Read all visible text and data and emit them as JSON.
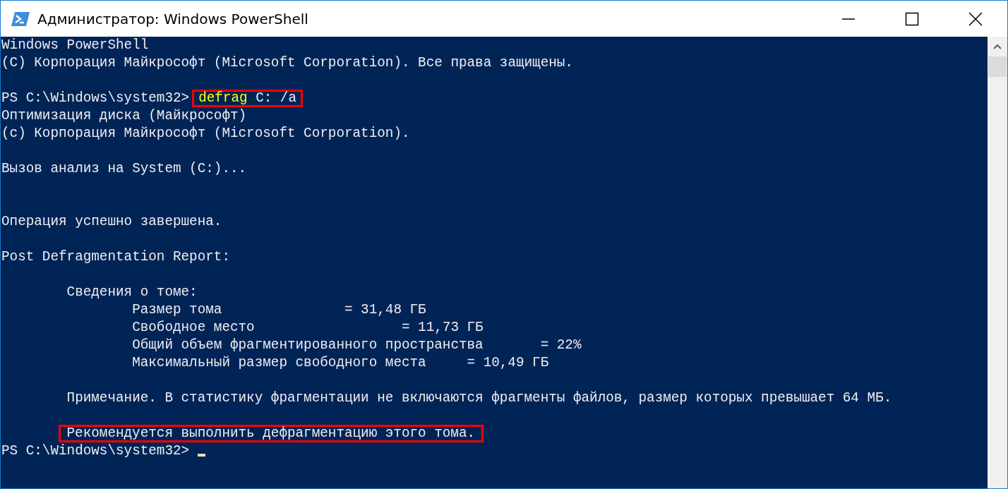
{
  "window": {
    "title": "Администратор: Windows PowerShell"
  },
  "console": {
    "lines": [
      {
        "kind": "text",
        "text": "Windows PowerShell"
      },
      {
        "kind": "text",
        "text": "(C) Корпорация Майкрософт (Microsoft Corporation). Все права защищены."
      },
      {
        "kind": "blank"
      },
      {
        "kind": "prompt",
        "prompt": "PS C:\\Windows\\system32>",
        "command": "defrag C: /a",
        "highlighted": true
      },
      {
        "kind": "text",
        "text": "Оптимизация диска (Майкрософт)"
      },
      {
        "kind": "text",
        "text": "(c) Корпорация Майкрософт (Microsoft Corporation)."
      },
      {
        "kind": "blank"
      },
      {
        "kind": "text",
        "text": "Вызов анализ на System (C:)..."
      },
      {
        "kind": "blank"
      },
      {
        "kind": "blank"
      },
      {
        "kind": "text",
        "text": "Операция успешно завершена."
      },
      {
        "kind": "blank"
      },
      {
        "kind": "text",
        "text": "Post Defragmentation Report:"
      },
      {
        "kind": "blank"
      },
      {
        "kind": "text",
        "indented": true,
        "text": "Сведения о томе:"
      },
      {
        "kind": "stat",
        "label": "Размер тома",
        "value": "= 31,48 ГБ"
      },
      {
        "kind": "stat",
        "label": "Свободное место",
        "value": "= 11,73 ГБ"
      },
      {
        "kind": "stat",
        "label": "Общий объем фрагментированного пространства",
        "value": "= 22%"
      },
      {
        "kind": "stat",
        "label": "Максимальный размер свободного места",
        "value": "= 10,49 ГБ"
      },
      {
        "kind": "blank"
      },
      {
        "kind": "text",
        "indented": true,
        "text": "Примечание. В статистику фрагментации не включаются фрагменты файлов, размер которых превышает 64 МБ."
      },
      {
        "kind": "blank"
      },
      {
        "kind": "text",
        "indented": true,
        "highlighted": true,
        "text": "Рекомендуется выполнить дефрагментацию этого тома."
      },
      {
        "kind": "prompt",
        "prompt": "PS C:\\Windows\\system32>",
        "cursor": true
      }
    ]
  }
}
